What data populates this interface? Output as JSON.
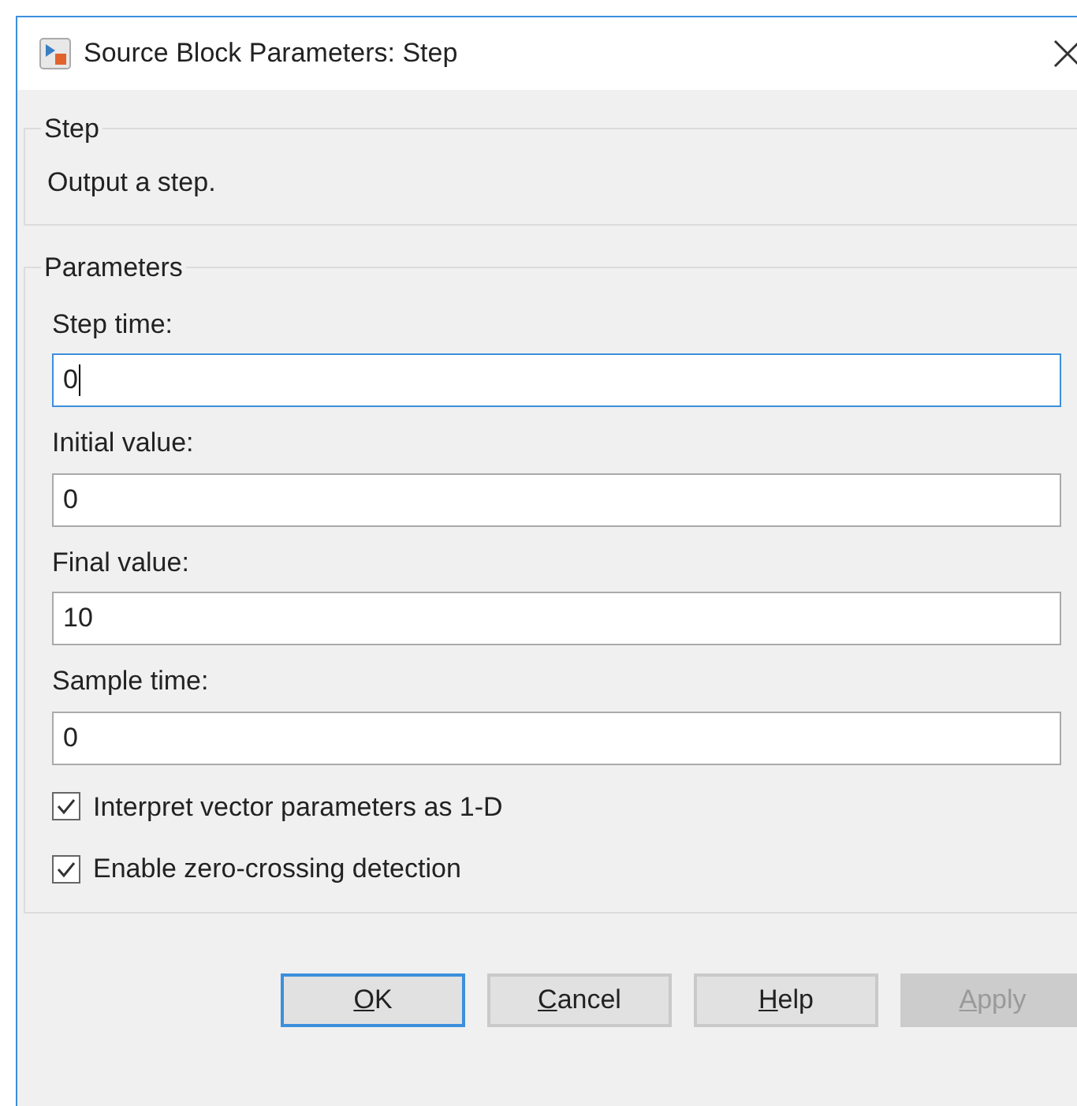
{
  "window": {
    "title": "Source Block Parameters: Step"
  },
  "description_group": {
    "title": "Step",
    "text": "Output a step."
  },
  "parameters_group": {
    "title": "Parameters",
    "fields": [
      {
        "label": "Step time:",
        "value": "0",
        "focused": true
      },
      {
        "label": "Initial value:",
        "value": "0",
        "focused": false
      },
      {
        "label": "Final value:",
        "value": "10",
        "focused": false
      },
      {
        "label": "Sample time:",
        "value": "0",
        "focused": false
      }
    ],
    "checkboxes": [
      {
        "label": "Interpret vector parameters as 1-D",
        "checked": true
      },
      {
        "label": "Enable zero-crossing detection",
        "checked": true
      }
    ]
  },
  "buttons": [
    {
      "label": "OK",
      "default": true,
      "disabled": false,
      "underline_first": true
    },
    {
      "label": "Cancel",
      "default": false,
      "disabled": false,
      "underline_first": true
    },
    {
      "label": "Help",
      "default": false,
      "disabled": false,
      "underline_first": true
    },
    {
      "label": "Apply",
      "default": false,
      "disabled": true,
      "underline_first": true
    }
  ]
}
